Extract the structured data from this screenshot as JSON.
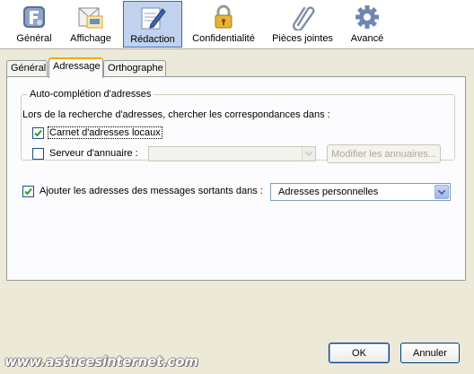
{
  "toolbar": {
    "items": [
      {
        "label": "Général",
        "icon": "general-icon"
      },
      {
        "label": "Affichage",
        "icon": "display-icon"
      },
      {
        "label": "Rédaction",
        "icon": "compose-icon",
        "active": true
      },
      {
        "label": "Confidentialité",
        "icon": "lock-icon"
      },
      {
        "label": "Pièces jointes",
        "icon": "paperclip-icon"
      },
      {
        "label": "Avancé",
        "icon": "gear-icon"
      }
    ]
  },
  "tabs": [
    {
      "label": "Général"
    },
    {
      "label": "Adressage",
      "active": true
    },
    {
      "label": "Orthographe"
    }
  ],
  "autocomplete": {
    "legend": "Auto-complétion d'adresses",
    "description": "Lors de la recherche d'adresses, chercher les correspondances dans :",
    "local_label": "Carnet d'adresses locaux",
    "local_checked": true,
    "server_label": "Serveur d'annuaire :",
    "server_checked": false,
    "server_value": "",
    "modify_label": "Modifier les annuaires..."
  },
  "outgoing": {
    "label": "Ajouter les adresses des messages sortants dans :",
    "checked": true,
    "selected": "Adresses personnelles"
  },
  "dialog": {
    "ok_label": "OK",
    "cancel_label": "Annuler"
  },
  "watermark": "www.astucesinternet.com",
  "colors": {
    "background": "#ece9d8",
    "accent": "#316ac5",
    "tab_highlight": "#f8a800"
  }
}
